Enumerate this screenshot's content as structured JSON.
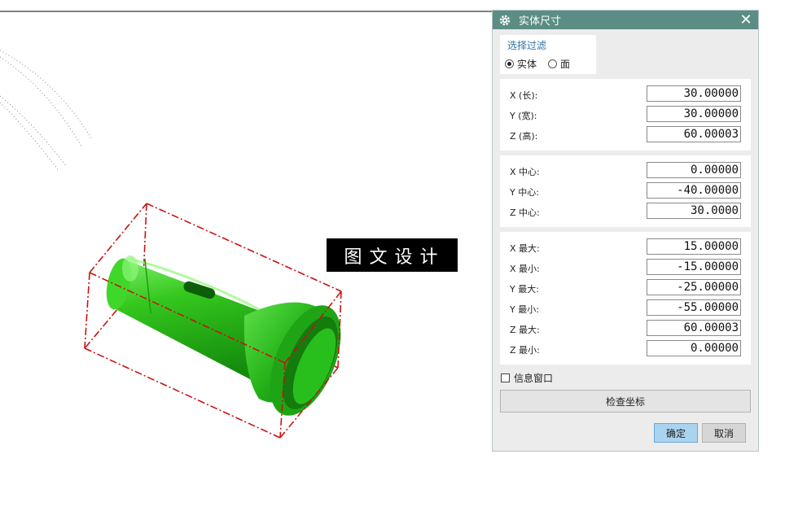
{
  "watermark": "图文设计",
  "dialog": {
    "title": "实体尺寸",
    "icon": "gear-icon",
    "filter": {
      "title": "选择过滤",
      "options": [
        {
          "label": "实体",
          "selected": true
        },
        {
          "label": "面",
          "selected": false
        }
      ]
    },
    "dimensions": [
      {
        "label": "X (长):",
        "value": "30.00000"
      },
      {
        "label": "Y (宽):",
        "value": "30.00000"
      },
      {
        "label": "Z (高):",
        "value": "60.00003"
      }
    ],
    "centers": [
      {
        "label": "X 中心:",
        "value": "0.00000"
      },
      {
        "label": "Y 中心:",
        "value": "-40.00000"
      },
      {
        "label": "Z 中心:",
        "value": "30.0000"
      }
    ],
    "extents": [
      {
        "label": "X 最大:",
        "value": "15.00000"
      },
      {
        "label": "X 最小:",
        "value": "-15.00000"
      },
      {
        "label": "Y 最大:",
        "value": "-25.00000"
      },
      {
        "label": "Y 最小:",
        "value": "-55.00000"
      },
      {
        "label": "Z 最大:",
        "value": "60.00003"
      },
      {
        "label": "Z 最小:",
        "value": "0.00000"
      }
    ],
    "info_window_label": "信息窗口",
    "info_window_checked": false,
    "check_coords_label": "检查坐标",
    "ok_label": "确定",
    "cancel_label": "取消"
  },
  "colors": {
    "titlebar": "#5b8d84",
    "part": "#22b41c",
    "bbox": "#cc1111",
    "ok_button": "#a9d3ef"
  }
}
